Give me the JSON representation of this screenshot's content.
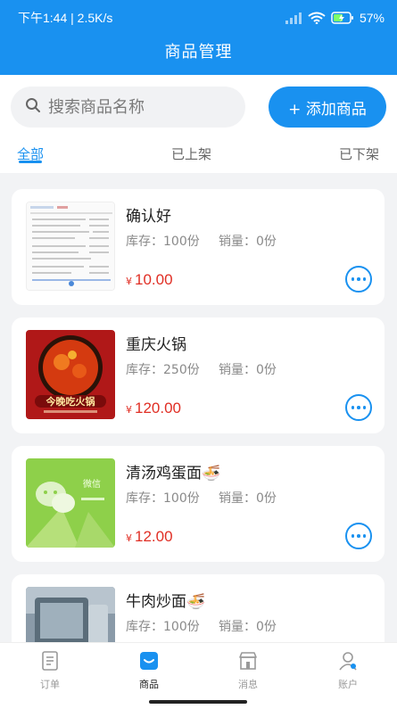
{
  "status": {
    "time": "下午1:44",
    "speed": "2.5K/s",
    "battery": "57%"
  },
  "header": {
    "title": "商品管理"
  },
  "search": {
    "placeholder": "搜索商品名称"
  },
  "add_button": {
    "label": "+ 添加商品"
  },
  "tabs": [
    {
      "label": "全部",
      "active": true
    },
    {
      "label": "已上架",
      "active": false
    },
    {
      "label": "已下架",
      "active": false
    }
  ],
  "products": [
    {
      "name": "确认好",
      "stock": "库存：100份",
      "sales": "销量：0份",
      "currency": "¥",
      "price": "10.00"
    },
    {
      "name": "重庆火锅",
      "stock": "库存：250份",
      "sales": "销量：0份",
      "currency": "¥",
      "price": "120.00",
      "thumb_text": "今晚吃火锅"
    },
    {
      "name": "清汤鸡蛋面🍜",
      "stock": "库存：100份",
      "sales": "销量：0份",
      "currency": "¥",
      "price": "12.00",
      "thumb_text": "微信"
    },
    {
      "name": "牛肉炒面🍜",
      "stock": "库存：100份",
      "sales": "销量：0份"
    }
  ],
  "nav": [
    {
      "label": "订单",
      "icon": "orders-icon",
      "active": false
    },
    {
      "label": "商品",
      "icon": "goods-icon",
      "active": true
    },
    {
      "label": "消息",
      "icon": "shop-icon",
      "active": false
    },
    {
      "label": "账户",
      "icon": "account-icon",
      "active": false
    }
  ],
  "colors": {
    "primary": "#1991f0",
    "price": "#e02e24",
    "background": "#f2f3f5"
  }
}
